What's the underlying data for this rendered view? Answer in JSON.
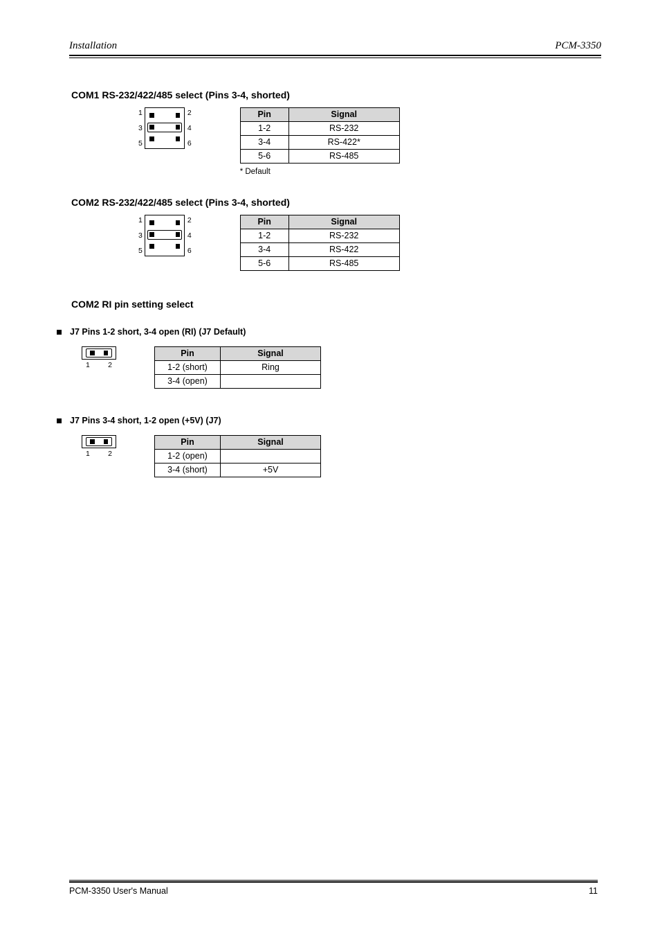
{
  "header": {
    "left": "Installation",
    "right": "PCM-3350"
  },
  "titles": {
    "com1": "COM1 RS-232/422/485 select (Pins 3-4, shorted)",
    "com2": "COM2 RS-232/422/485 select (Pins 3-4, shorted)",
    "irq12": "COM2 RI pin setting select",
    "sub1": "J7 Pins 1-2 short, 3-4 open (RI)",
    "sub1_alias": "(J7 Default)",
    "sub2": "J7 Pins 3-4 short, 1-2 open (+5V)",
    "sub2_alias": "(J7)"
  },
  "tables": {
    "com1": {
      "headers": [
        "Pin",
        "Signal"
      ],
      "rows": [
        [
          "1-2",
          "RS-232"
        ],
        [
          "3-4",
          "RS-422*"
        ],
        [
          "5-6",
          "RS-485"
        ]
      ]
    },
    "com2": {
      "headers": [
        "Pin",
        "Signal"
      ],
      "rows": [
        [
          "1-2",
          "RS-232"
        ],
        [
          "3-4",
          "RS-422"
        ],
        [
          "5-6",
          "RS-485"
        ]
      ]
    },
    "j7a": {
      "headers": [
        "Pin",
        "Signal"
      ],
      "rows": [
        [
          "1-2 (short)",
          "Ring"
        ],
        [
          "3-4 (open)",
          ""
        ]
      ]
    },
    "j7b": {
      "headers": [
        "Pin",
        "Signal"
      ],
      "rows": [
        [
          "1-2 (open)",
          ""
        ],
        [
          "3-4 (short)",
          "+5V"
        ]
      ]
    }
  },
  "pinlabels": {
    "left": [
      "1",
      "3",
      "5"
    ],
    "right": [
      "2",
      "4",
      "6"
    ],
    "j7_left": "1",
    "j7_right": "2"
  },
  "footnote": "* Default",
  "footer": {
    "left": "PCM-3350 User's Manual",
    "right": "11"
  }
}
